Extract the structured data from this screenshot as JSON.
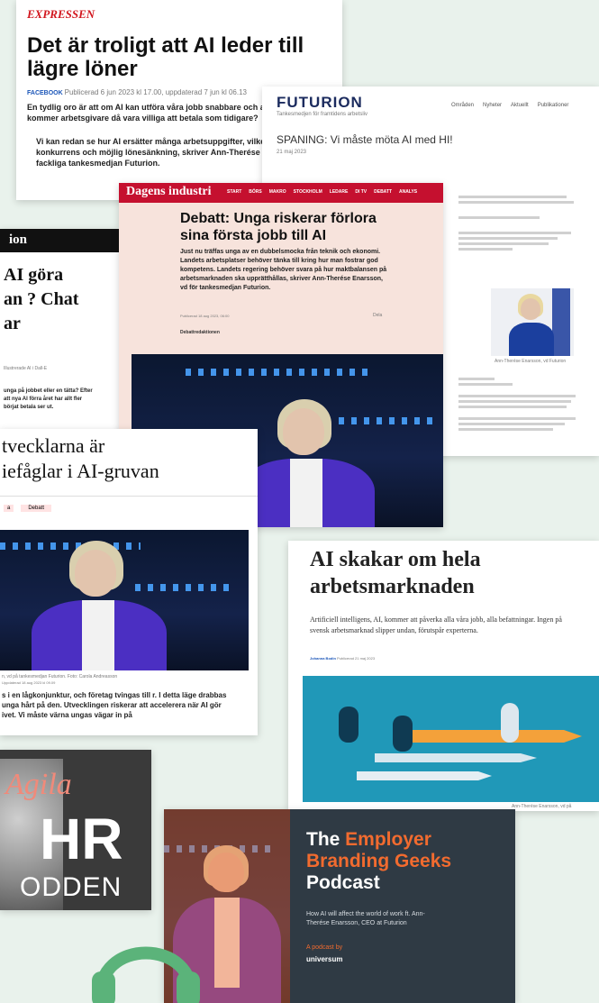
{
  "expressen": {
    "logo": "EXPRESSEN",
    "headline": "Det är troligt att AI leder till lägre löner",
    "byline_source": "FACEBOOK",
    "byline_date": "Publicerad 6 jun 2023 kl 17.00, uppdaterad 7 jun kl 06.13",
    "lead": "En tydlig oro är att om AI kan utföra våra jobb snabbare och av kostnaden, kommer arbetsgivare då vara villiga att betala som tidigare?",
    "body": "Vi kan redan se hur AI ersätter många arbetsuppgifter, vilket ökad konkurrens och möjlig lönesänkning, skriver Ann-Therése från den fackliga tankesmedjan Futurion."
  },
  "futurion": {
    "logo": "FUTURION",
    "tagline": "Tankesmedjen för framtidens arbetsliv",
    "nav": [
      "Områden",
      "Nyheter",
      "Aktuellt",
      "Publikationer"
    ],
    "headline": "SPANING: Vi måste möta AI med HI!",
    "date": "21 maj 2023",
    "caption": "Ann-Therése Enarsson, vd Futurion"
  },
  "di": {
    "logo": "Dagens industri",
    "nav": [
      "START",
      "BÖRS",
      "MAKRO",
      "STOCKHOLM",
      "LEDARE",
      "DI TV",
      "DEBATT",
      "ANALYS"
    ],
    "headline": "Debatt: Unga riskerar förlora sina första jobb till AI",
    "lead": "Just nu träffas unga av en dubbelsmocka från teknik och ekonomi. Landets arbetsplatser behöver tänka till kring hur man fostrar god kompetens. Landets regering behöver svara på hur maktbalansen på arbetsmarknaden ska upprätthållas, skriver Ann-Therése Enarsson, vd för tankesmedjan Futurion.",
    "date": "Publicerad 18 aug 2023, 06:00",
    "author": "Debattredaktionen",
    "share": "Dela"
  },
  "chat": {
    "nameplate": "ion",
    "headline": "AI göra an ? Chat ar",
    "byline": "Illustrerade AI i Dall-E",
    "lead": "unga på jobbet eller en tätta? Efter att nya AI förra året har allt fler börjat betala ser ut."
  },
  "gruvan": {
    "headline_1": "tvecklarna är",
    "headline_2": "iefåglar i AI-gruvan",
    "tag_1": "a",
    "tag_2": "Debatt",
    "caption": "n, vd på tankesmedjan Futurion. Foto: Carola Andreasson",
    "date": "Uppdaterad 18 aug 2023 kl 09.09",
    "body": "s i en lågkonjunktur, och företag tvingas till r. I detta läge drabbas unga hårt på den. Utvecklingen riskerar att accelerera när AI gör ivet. Vi måste värna ungas vägar in på"
  },
  "arbetsmarknad": {
    "headline": "AI skakar om hela arbetsmarknaden",
    "lead": "Artificiell intelligens, AI, kommer att påverka alla våra jobb, alla befattningar. Ingen på svensk arbetsmarknad slipper undan, förutspår experterna.",
    "byline": "Johanna Bodin",
    "date": "Publicerad 21 maj 2023",
    "caption": "Ann-Therése Enarsson, vd på"
  },
  "agila": {
    "title_1": "Agila",
    "title_2": "HR",
    "title_3": "ODDEN"
  },
  "geeks": {
    "the": "The ",
    "employer": "Employer",
    "branding": "Branding ",
    "geeks": "Geeks",
    "podcast": "Podcast",
    "desc": "How AI will affect the world of work ft. Ann-Therése Enarsson, CEO at Futurion",
    "byline": "A podcast by",
    "brand": "universum"
  },
  "colors": {
    "background": "#e9f2ec",
    "expressen_red": "#d2171f",
    "di_pink": "#f7e3dc",
    "geeks_orange": "#f26b2f",
    "headphones_green": "#5bb37a"
  }
}
